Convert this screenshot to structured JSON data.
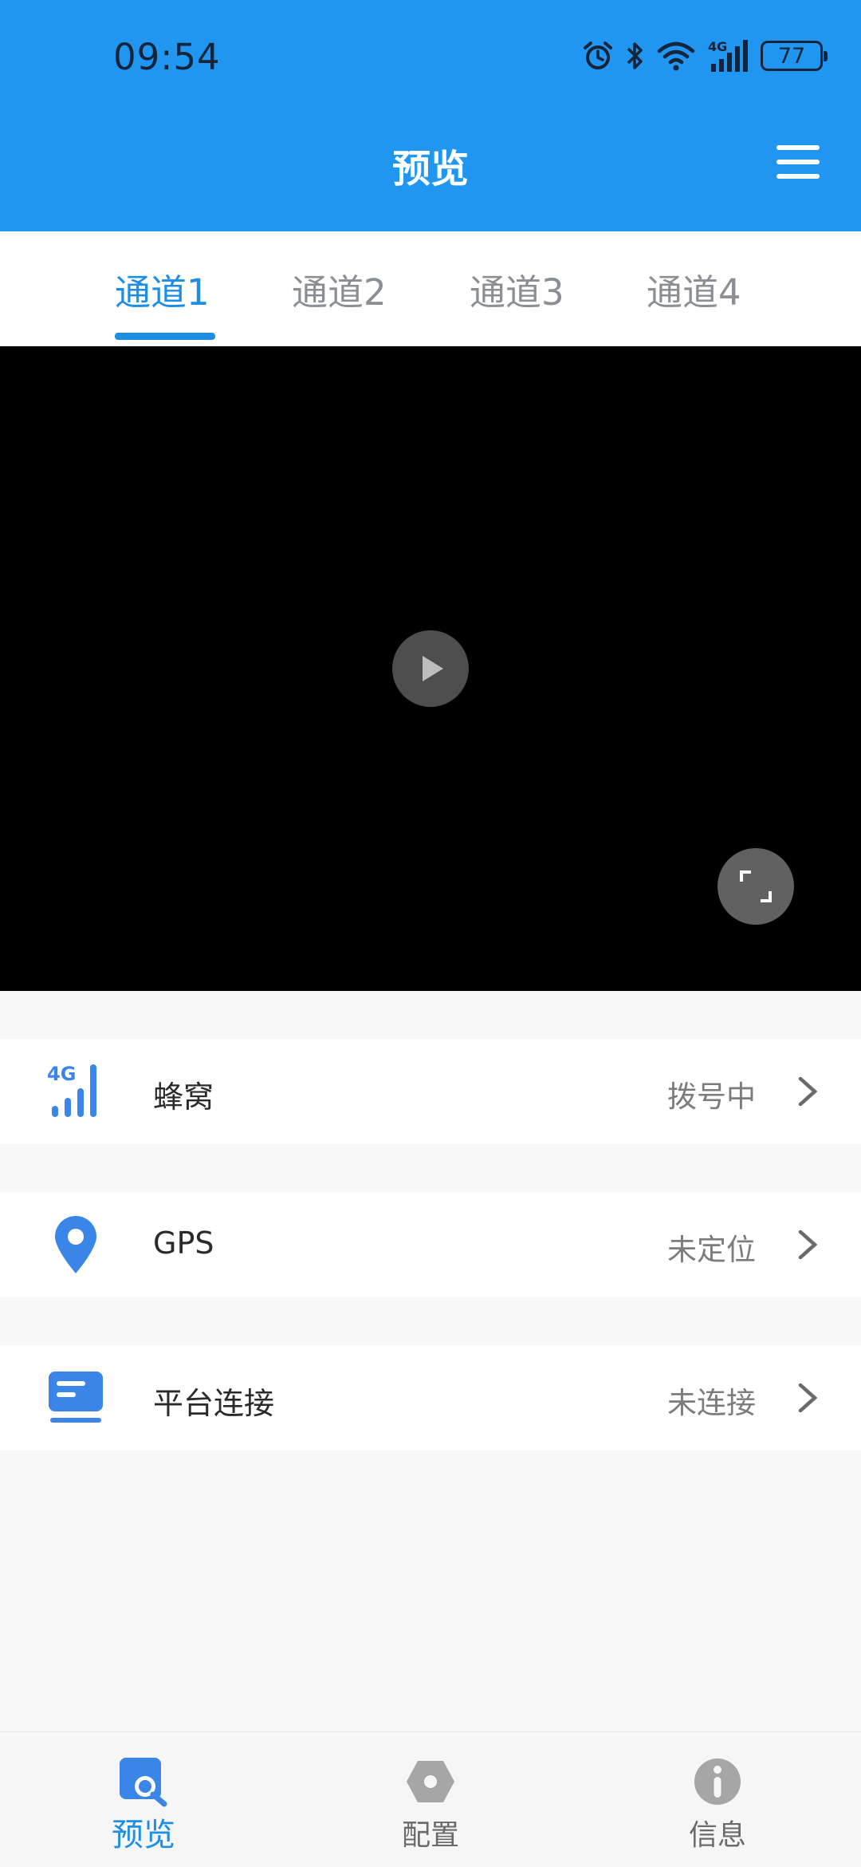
{
  "status_bar": {
    "time": "09:54",
    "network": "4G",
    "battery": "77",
    "icons": [
      "alarm-icon",
      "bluetooth-icon",
      "wifi-icon",
      "cellular-4g-icon",
      "battery-icon"
    ]
  },
  "header": {
    "title": "预览",
    "menu_icon": "hamburger-menu-icon"
  },
  "tabs": [
    {
      "label": "通道1",
      "active": true
    },
    {
      "label": "通道2",
      "active": false
    },
    {
      "label": "通道3",
      "active": false
    },
    {
      "label": "通道4",
      "active": false
    }
  ],
  "video": {
    "play_icon": "play-icon",
    "fullscreen_icon": "fullscreen-icon"
  },
  "status_rows": [
    {
      "icon": "cellular-4g-icon",
      "icon_text": "4G",
      "label": "蜂窝",
      "value": "拨号中"
    },
    {
      "icon": "location-pin-icon",
      "label": "GPS",
      "value": "未定位"
    },
    {
      "icon": "platform-icon",
      "label": "平台连接",
      "value": "未连接"
    }
  ],
  "bottom_nav": [
    {
      "label": "预览",
      "icon": "preview-search-icon",
      "active": true
    },
    {
      "label": "配置",
      "icon": "hex-nut-icon",
      "active": false
    },
    {
      "label": "信息",
      "icon": "info-icon",
      "active": false
    }
  ],
  "colors": {
    "header_bg": "#2196f0",
    "accent": "#1e8ee4",
    "video_bg": "#000000",
    "page_bg": "#f8f8f8"
  }
}
